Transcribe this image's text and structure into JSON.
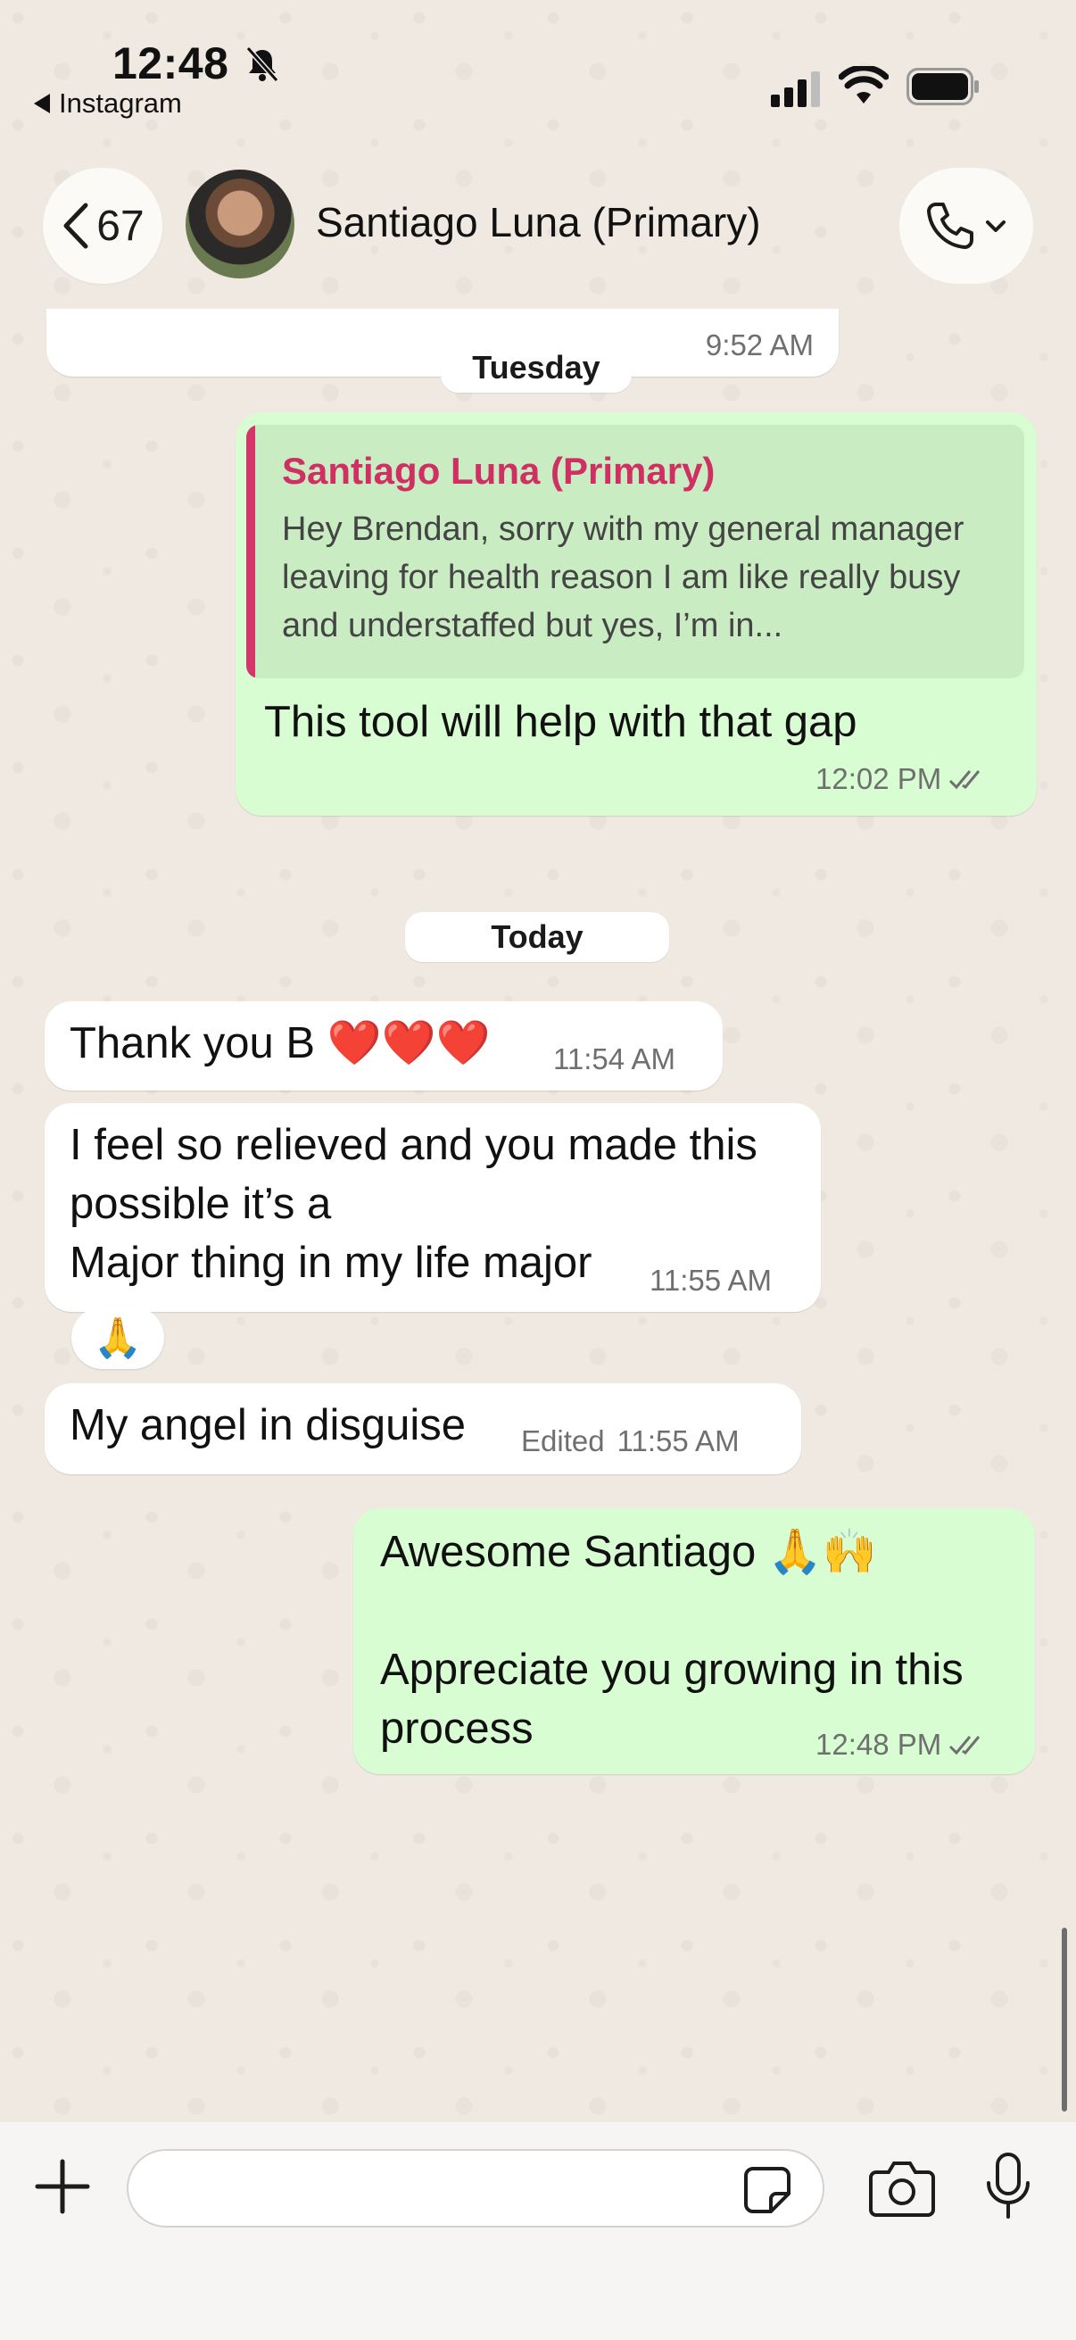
{
  "status_bar": {
    "time": "12:48",
    "back_app": "Instagram"
  },
  "header": {
    "back_count": "67",
    "contact_name": "Santiago Luna (Primary)"
  },
  "messages": [
    {
      "id": "m0",
      "direction": "incoming",
      "time": "9:52 AM"
    },
    {
      "id": "chip-tuesday",
      "type": "date",
      "label": "Tuesday"
    },
    {
      "id": "m1",
      "direction": "outgoing",
      "quote": {
        "author": "Santiago Luna (Primary)",
        "text": "Hey Brendan, sorry with my general manager leaving for health reason I am like really busy and understaffed but yes, I’m in..."
      },
      "text": "This tool will help with that gap",
      "time": "12:02 PM"
    },
    {
      "id": "chip-today",
      "type": "date",
      "label": "Today"
    },
    {
      "id": "m2",
      "direction": "incoming",
      "text": "Thank you B ❤️❤️❤️",
      "time": "11:54 AM"
    },
    {
      "id": "m3",
      "direction": "incoming",
      "text": "I feel so relieved and you made this\npossible it’s a\nMajor thing in my life major",
      "time": "11:55 AM",
      "reaction": "🙏"
    },
    {
      "id": "m4",
      "direction": "incoming",
      "text": "My angel in disguise",
      "edited": "Edited",
      "time": "11:55 AM"
    },
    {
      "id": "m5",
      "direction": "outgoing",
      "text": "Awesome Santiago 🙏🙌\n\nAppreciate you growing in this\nprocess",
      "time": "12:48 PM"
    }
  ],
  "composer": {
    "input_value": "",
    "input_placeholder": ""
  },
  "icons": [
    "bell-off-icon",
    "signal-icon",
    "wifi-icon",
    "battery-icon",
    "chevron-left-icon",
    "phone-icon",
    "chevron-down-icon",
    "plus-icon",
    "sticker-icon",
    "camera-icon",
    "microphone-icon",
    "double-check-icon"
  ]
}
